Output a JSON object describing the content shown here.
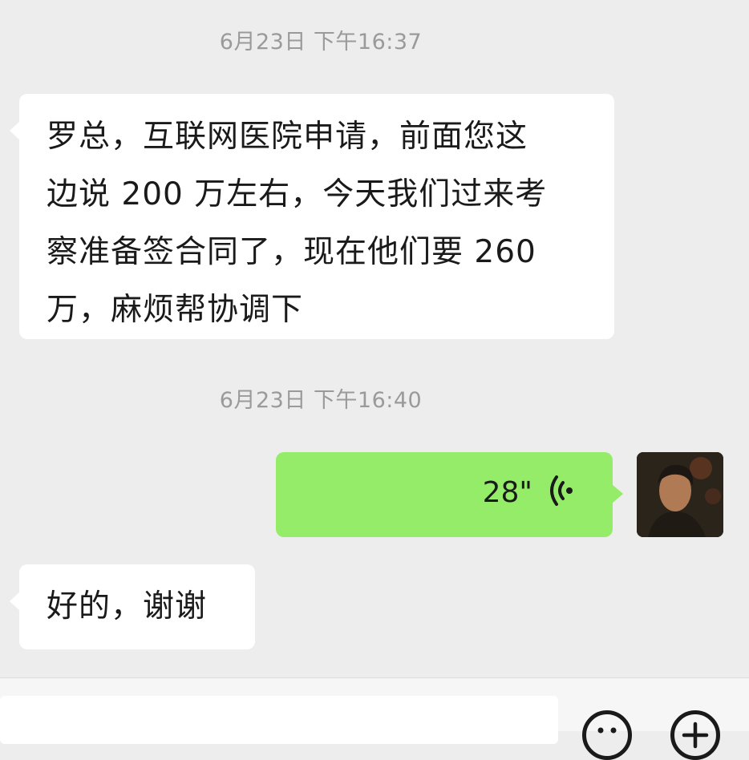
{
  "messages": [
    {
      "type": "timestamp",
      "text": "6月23日 下午16:37"
    },
    {
      "type": "text",
      "direction": "incoming",
      "lines": [
        "罗总，互联网医院申请，前面您这",
        "边说 200 万左右，今天我们过来考",
        "察准备签合同了，现在他们要 260",
        "万，麻烦帮协调下"
      ]
    },
    {
      "type": "timestamp",
      "text": "6月23日 下午16:40"
    },
    {
      "type": "voice",
      "direction": "outgoing",
      "duration": "28\""
    },
    {
      "type": "text",
      "direction": "incoming",
      "lines": [
        "好的，谢谢"
      ]
    }
  ],
  "icons": {
    "voice": "voice-wave-icon",
    "emoji": "emoji-icon",
    "more": "plus-icon"
  },
  "colors": {
    "background": "#ededed",
    "outgoing_bubble": "#95ec69",
    "incoming_bubble": "#ffffff",
    "timestamp": "#9a9a9a"
  }
}
